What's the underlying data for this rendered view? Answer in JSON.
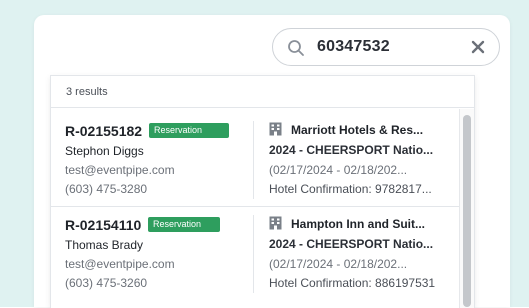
{
  "search": {
    "value": "60347532",
    "icon": "search-icon",
    "clear_icon": "close-icon"
  },
  "results": {
    "count_label": "3 results",
    "items": [
      {
        "id": "R-02155182",
        "badge": "Reservation",
        "guest_name": "Stephon Diggs",
        "email": "test@eventpipe.com",
        "phone": "(603) 475-3280",
        "hotel": "Marriott Hotels & Res...",
        "event": "2024 - CHEERSPORT Natio...",
        "dates": "(02/17/2024 - 02/18/202...",
        "confirmation": "Hotel Confirmation: 9782817..."
      },
      {
        "id": "R-02154110",
        "badge": "Reservation",
        "guest_name": "Thomas Brady",
        "email": "test@eventpipe.com",
        "phone": "(603) 475-3260",
        "hotel": "Hampton Inn and Suit...",
        "event": "2024 - CHEERSPORT Natio...",
        "dates": "(02/17/2024 - 02/18/202...",
        "confirmation": "Hotel Confirmation: 886197531"
      }
    ]
  },
  "colors": {
    "background": "#dff2f1",
    "badge": "#2e9e5e",
    "text_primary": "#1f2329",
    "text_secondary": "#6b7078"
  }
}
